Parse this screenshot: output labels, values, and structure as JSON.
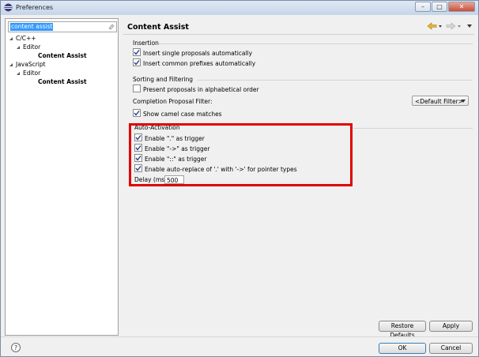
{
  "window": {
    "title": "Preferences"
  },
  "caption": {
    "minimize": "–",
    "maximize": "□",
    "close": "✕"
  },
  "filter": {
    "value": "content assist"
  },
  "tree": [
    {
      "label": "C/C++"
    },
    {
      "label": "Editor"
    },
    {
      "label": "Content Assist"
    },
    {
      "label": "JavaScript"
    },
    {
      "label": "Editor"
    },
    {
      "label": "Content Assist"
    }
  ],
  "page": {
    "title": "Content Assist"
  },
  "insertion": {
    "title": "Insertion",
    "single": "Insert single proposals automatically",
    "prefixes": "Insert common prefixes automatically"
  },
  "sorting": {
    "title": "Sorting and Filtering",
    "alphabetical": "Present proposals in alphabetical order",
    "completion_filter_label": "Completion Proposal Filter:",
    "filter_value": "<Default Filter>",
    "camel": "Show camel case matches"
  },
  "auto_activation": {
    "title": "Auto-Activation",
    "dot": "Enable \".\" as trigger",
    "arrow": "Enable \"->\" as trigger",
    "scope": "Enable \"::\" as trigger",
    "replace": "Enable auto-replace of '.' with '->' for pointer types",
    "delay_label": "Delay (ms)",
    "delay_value": "500"
  },
  "buttons": {
    "restore": "Restore Defaults",
    "apply": "Apply",
    "ok": "OK",
    "cancel": "Cancel"
  },
  "help_symbol": "?",
  "colors": {
    "highlight": "#e00000",
    "selection": "#3399ff"
  }
}
